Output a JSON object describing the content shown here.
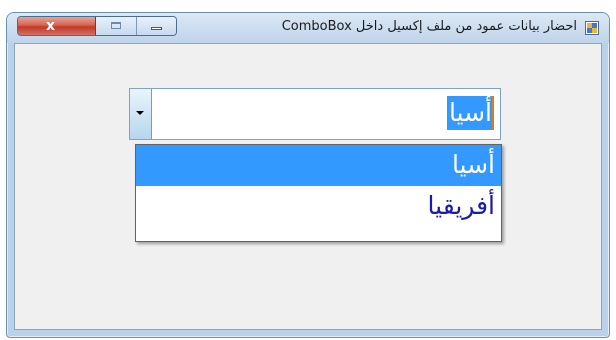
{
  "window": {
    "title": "احضار بيانات عمود من ملف إكسيل داخل ComboBox",
    "icon": "form-icon",
    "caption_buttons": [
      "minimize-icon",
      "maximize-icon",
      "close-icon"
    ],
    "close_glyph": "x"
  },
  "combo": {
    "value": "أسيا",
    "arrow_icon": "chevron-down-icon"
  },
  "dropdown": {
    "items": [
      "أسيا",
      "أفريقيا"
    ],
    "selected_index": 0
  },
  "colors": {
    "highlight": "#3399ff",
    "item_text": "#1a1aad"
  }
}
